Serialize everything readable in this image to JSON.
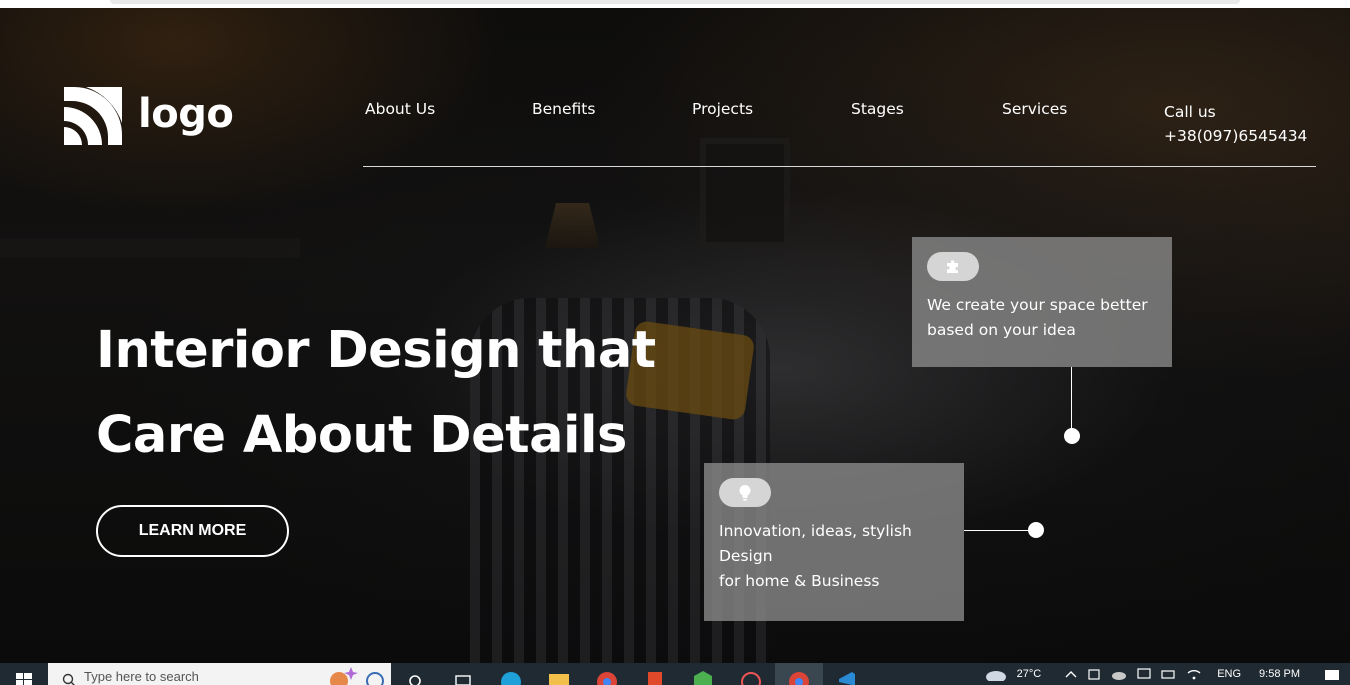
{
  "brand": {
    "logo_text": "logo"
  },
  "nav": {
    "items": [
      {
        "label": "About Us"
      },
      {
        "label": "Benefits"
      },
      {
        "label": "Projects"
      },
      {
        "label": "Stages"
      },
      {
        "label": "Services"
      }
    ],
    "call_label": "Call us",
    "phone": "+38(097)6545434"
  },
  "hero": {
    "headline_line1": "Interior Design that",
    "headline_line2": "Care About Details",
    "cta_label": "LEARN MORE"
  },
  "cards": {
    "card1": {
      "icon": "puzzle-icon",
      "text": "We create your space better based on your idea"
    },
    "card2": {
      "icon": "lightbulb-icon",
      "line1": "Innovation, ideas, stylish Design",
      "line2": "for home & Business"
    }
  },
  "taskbar": {
    "search_placeholder": "Type here to search",
    "weather": "27°C",
    "language": "ENG",
    "time": "9:58 PM"
  },
  "colors": {
    "card_bg": "#8c8c8c",
    "taskbar_bg": "#1f2a33"
  }
}
